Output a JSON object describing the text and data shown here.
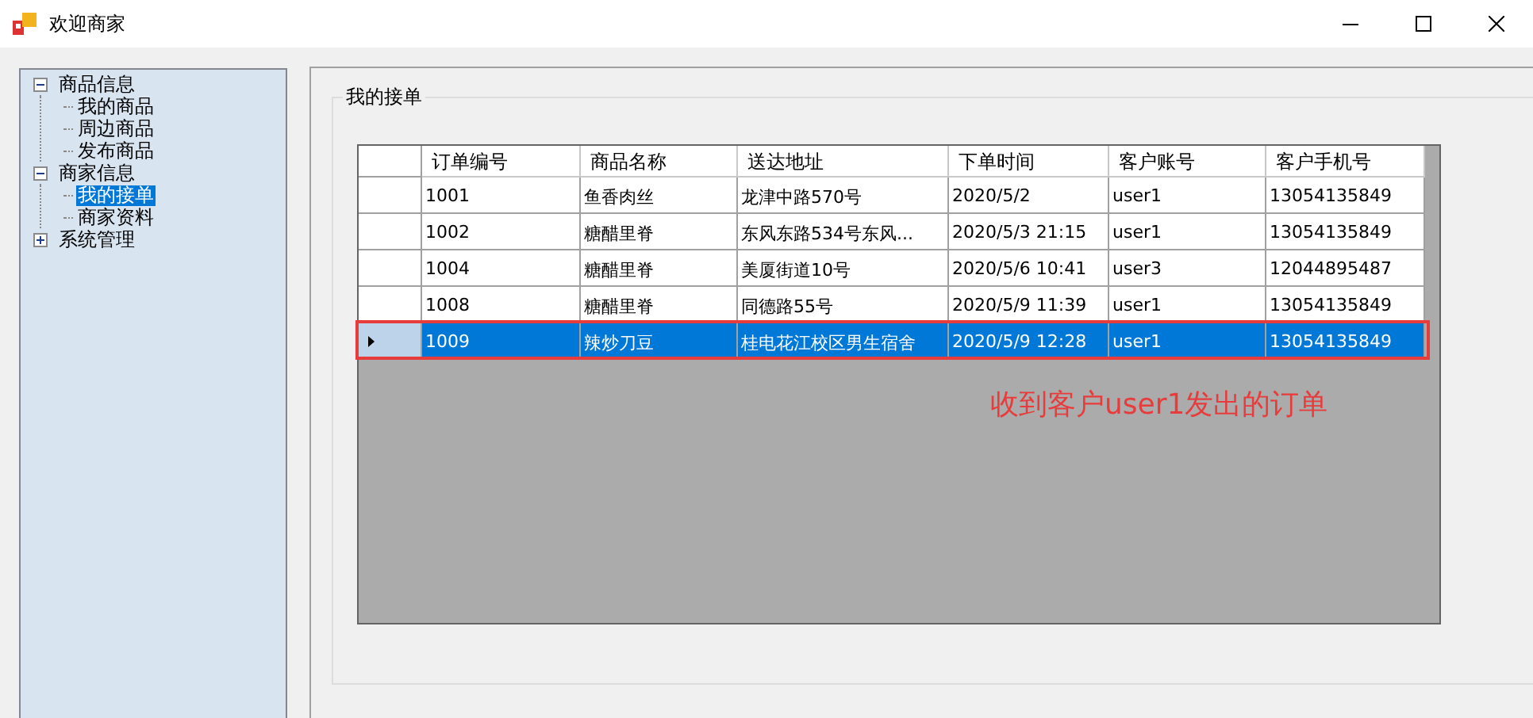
{
  "window": {
    "title": "欢迎商家"
  },
  "tree": [
    {
      "label": "商品信息",
      "expanded": true,
      "selected": false,
      "children": [
        {
          "label": "我的商品",
          "selected": false
        },
        {
          "label": "周边商品",
          "selected": false
        },
        {
          "label": "发布商品",
          "selected": false
        }
      ]
    },
    {
      "label": "商家信息",
      "expanded": true,
      "selected": false,
      "children": [
        {
          "label": "我的接单",
          "selected": true
        },
        {
          "label": "商家资料",
          "selected": false
        }
      ]
    },
    {
      "label": "系统管理",
      "expanded": false,
      "selected": false
    }
  ],
  "group": {
    "title": "我的接单"
  },
  "table": {
    "columns": [
      "订单编号",
      "商品名称",
      "送达地址",
      "下单时间",
      "客户账号",
      "客户手机号"
    ],
    "rows": [
      {
        "selected": false,
        "cells": [
          "1001",
          "鱼香肉丝",
          "龙津中路570号",
          "2020/5/2",
          "user1",
          "13054135849"
        ]
      },
      {
        "selected": false,
        "cells": [
          "1002",
          "糖醋里脊",
          "东风东路534号东风...",
          "2020/5/3 21:15",
          "user1",
          "13054135849"
        ]
      },
      {
        "selected": false,
        "cells": [
          "1004",
          "糖醋里脊",
          "美厦街道10号",
          "2020/5/6 10:41",
          "user3",
          "12044895487"
        ]
      },
      {
        "selected": false,
        "cells": [
          "1008",
          "糖醋里脊",
          "同德路55号",
          "2020/5/9 11:39",
          "user1",
          "13054135849"
        ]
      },
      {
        "selected": true,
        "cells": [
          "1009",
          "辣炒刀豆",
          "桂电花江校区男生宿舍",
          "2020/5/9 12:28",
          "user1",
          "13054135849"
        ]
      }
    ]
  },
  "annotation": {
    "text": "收到客户user1发出的订单"
  }
}
